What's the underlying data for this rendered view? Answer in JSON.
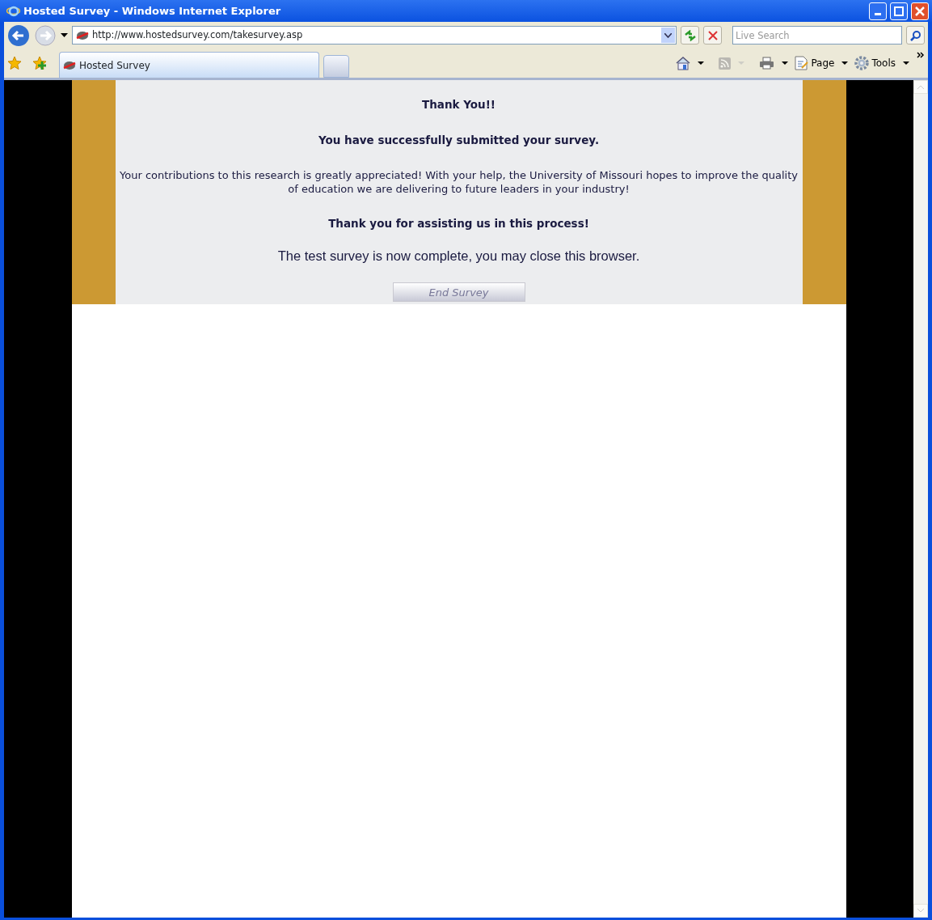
{
  "window": {
    "title": "Hosted Survey - Windows Internet Explorer"
  },
  "address_bar": {
    "url": "http://www.hostedsurvey.com/takesurvey.asp"
  },
  "search": {
    "placeholder": "Live Search"
  },
  "tabs": [
    {
      "label": "Hosted Survey",
      "selected": true
    }
  ],
  "command_bar": [
    {
      "kind": "home"
    },
    {
      "kind": "feeds",
      "disabled": true
    },
    {
      "kind": "print"
    },
    {
      "kind": "page",
      "label": "Page"
    },
    {
      "kind": "tools",
      "label": "Tools"
    }
  ],
  "content": {
    "heading": "Thank You!!",
    "subheading": "You have successfully submitted your survey.",
    "message": "Your contributions to this research is greatly appreciated! With your help, the University of Missouri hopes to improve the quality of education we are delivering to future leaders in your industry!",
    "thanks": "Thank you for assisting us in this process!",
    "note": "The test survey is now complete, you may close this browser.",
    "button": "End Survey"
  }
}
